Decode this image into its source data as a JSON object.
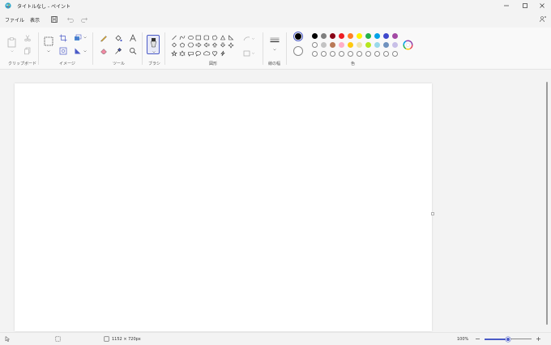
{
  "window": {
    "title": "タイトルなし - ペイント"
  },
  "menu": {
    "file": "ファイル",
    "view": "表示"
  },
  "ribbon": {
    "groups": {
      "clipboard": "クリップボード",
      "image": "イメージ",
      "tools": "ツール",
      "brush": "ブラシ",
      "shapes": "図形",
      "size": "線の幅",
      "colors": "色"
    }
  },
  "colors": {
    "primary": "#000000",
    "secondary": "#ffffff",
    "row1": [
      "#000000",
      "#7f7f7f",
      "#880015",
      "#ed1c24",
      "#ff7f27",
      "#fff200",
      "#22b14c",
      "#00a2e8",
      "#3f48cc",
      "#a349a4"
    ],
    "row2": [
      "#ffffff",
      "#c3c3c3",
      "#b97a57",
      "#ffaec9",
      "#ffc90e",
      "#efe4b0",
      "#b5e61d",
      "#99d9ea",
      "#7092be",
      "#c8bfe7"
    ],
    "accent": "#4b5bc7"
  },
  "status": {
    "canvas_size": "1152 × 720px",
    "zoom": "100%",
    "zoom_level": 0.5
  }
}
